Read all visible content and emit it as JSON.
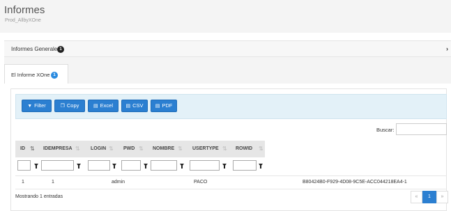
{
  "header": {
    "title": "Informes",
    "subtitle": "Prod_AllbyXOne"
  },
  "section": {
    "label": "Informes Generales",
    "badge": "1",
    "collapse_glyph": "›"
  },
  "tab": {
    "label": "El Informe XOne",
    "badge": "1"
  },
  "toolbar": {
    "filter_label": "Filter",
    "copy_label": "Copy",
    "excel_label": "Excel",
    "csv_label": "CSV",
    "pdf_label": "PDF"
  },
  "search": {
    "label": "Buscar:",
    "value": ""
  },
  "table": {
    "columns": [
      "ID",
      "IDEMPRESA",
      "LOGIN",
      "PWD",
      "NOMBRE",
      "USERTYPE",
      "ROWID"
    ],
    "rows": [
      [
        "1",
        "1",
        "admin",
        "",
        "",
        "PACO",
        "B80424B0-F929-4D08-9C5E-ACC044218EA4-1"
      ]
    ]
  },
  "footer": {
    "info": "Mostrando 1 entradas"
  },
  "pagination": {
    "prev": "«",
    "current": "1",
    "next": "»"
  },
  "colors": {
    "accent": "#2b7fd1",
    "toolbar_bg": "#e3f1f8",
    "badge_blue": "#2a8be0"
  }
}
